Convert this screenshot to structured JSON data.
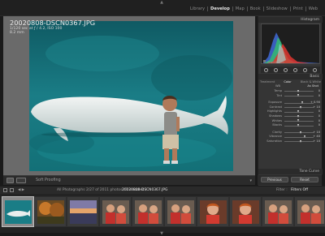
{
  "app": {
    "modules": [
      "Library",
      "Develop",
      "Map",
      "Book",
      "Slideshow",
      "Print",
      "Web"
    ],
    "active_module": "Develop"
  },
  "photo_info": {
    "filename": "20020808-DSCN0367.JPG",
    "exposure": "1/120 sec at ƒ / 4.2, ISO 100",
    "focal_length": "8.2 mm"
  },
  "toolbar": {
    "soft_proofing_label": "Soft Proofing"
  },
  "right_panel": {
    "histogram_label": "Histogram",
    "original_photo_label": "Original Photo",
    "basic_label": "Basic",
    "treatment_tabs": [
      "Treatment",
      "Color",
      "Black & White"
    ],
    "wb_label": "WB",
    "wb_value": "As Shot",
    "tone_label": "Tone",
    "tone_value": "Auto",
    "presence_label": "Presence",
    "sliders": [
      {
        "label": "Temp",
        "value": "0",
        "level": 0.5
      },
      {
        "label": "Tint",
        "value": "0",
        "level": 0.5
      },
      {
        "label": "Exposure",
        "value": "+ 0.90",
        "level": 0.62
      },
      {
        "label": "Contrast",
        "value": "+ 10",
        "level": 0.56
      },
      {
        "label": "Highlights",
        "value": "0",
        "level": 0.5
      },
      {
        "label": "Shadows",
        "value": "0",
        "level": 0.5
      },
      {
        "label": "Whites",
        "value": "0",
        "level": 0.5
      },
      {
        "label": "Blacks",
        "value": "0",
        "level": 0.5
      },
      {
        "label": "Clarity",
        "value": "+ 10",
        "level": 0.56
      },
      {
        "label": "Vibrance",
        "value": "+ 40",
        "level": 0.7
      },
      {
        "label": "Saturation",
        "value": "+ 10",
        "level": 0.56
      }
    ],
    "tone_curve_label": "Tone Curve",
    "previous_button": "Previous",
    "reset_button": "Reset"
  },
  "filmstrip_bar": {
    "count_label": "All Photographs",
    "selection_info": "2/27 of 2011 photos / 1 selected /",
    "selected_file": "20020808-DSCN0367.JPG",
    "filter_label": "Filter :",
    "filter_value": "Filters Off"
  },
  "filmstrip": {
    "thumbnails": [
      "beluga",
      "autumn",
      "sunset",
      "kids-red",
      "kids-red",
      "kids-red",
      "child-portrait",
      "child-portrait",
      "kids-red",
      "kids-red"
    ]
  }
}
